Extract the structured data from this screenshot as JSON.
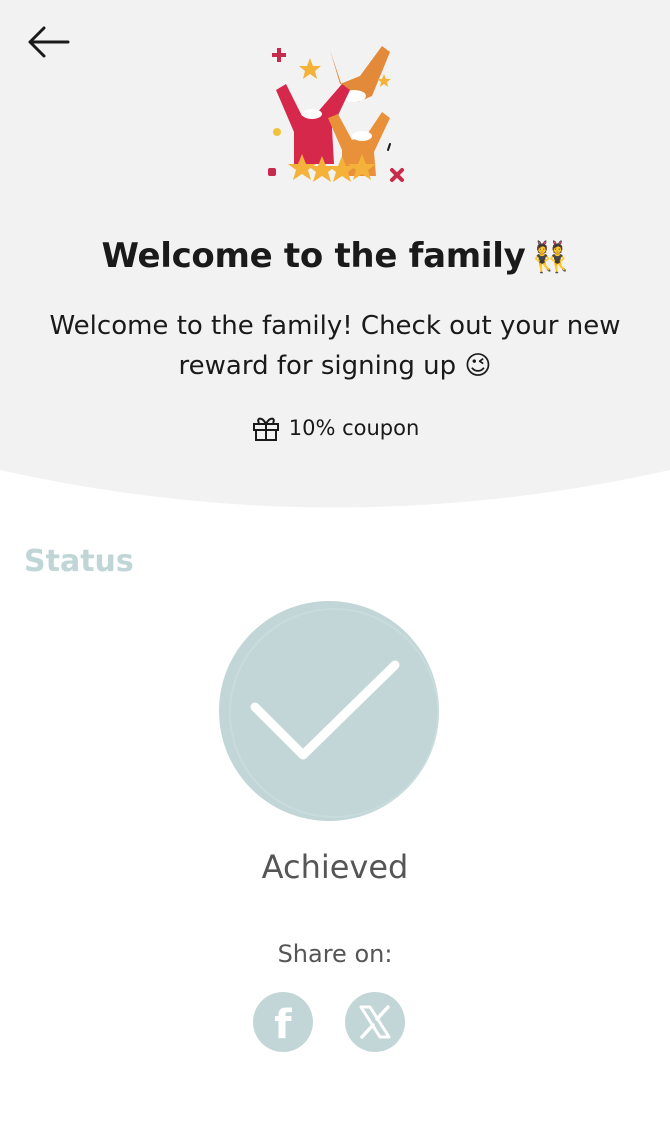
{
  "header": {
    "back_icon": "arrow-left-icon",
    "hero_icon": "celebration-illustration-icon",
    "title": "Welcome to the family",
    "title_emoji": "👯",
    "subtitle": "Welcome to the family! Check out your new reward for signing up 😉",
    "reward": {
      "icon": "gift-icon",
      "label": "10% coupon"
    }
  },
  "status": {
    "label": "Status",
    "icon": "checkmark-icon",
    "value": "Achieved"
  },
  "share": {
    "label": "Share on:",
    "facebook": {
      "icon": "facebook-icon",
      "glyph": "f"
    },
    "x": {
      "icon": "x-icon",
      "glyph": "𝕏"
    }
  },
  "colors": {
    "header_bg": "#f2f2f2",
    "accent": "#c2d6d7",
    "status_label": "#bfd5d6",
    "text_dark": "#1a1a1a",
    "text_muted": "#555555"
  }
}
